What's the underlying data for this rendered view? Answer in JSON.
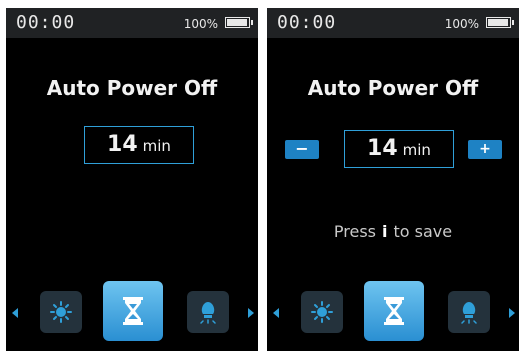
{
  "status": {
    "time": "00:00",
    "battery_percent": "100%",
    "battery_level": 1.0
  },
  "panels": [
    {
      "title": "Auto Power Off",
      "value": "14",
      "unit": "min"
    },
    {
      "title": "Auto Power Off",
      "value": "14",
      "unit": "min",
      "minus_label": "−",
      "plus_label": "+",
      "hint_prefix": "Press",
      "hint_key": "i",
      "hint_suffix": "to save"
    }
  ],
  "menu_icons": [
    "brightness-icon",
    "timer-icon",
    "lamp-icon"
  ],
  "selected_icon": "timer-icon",
  "colors": {
    "accent": "#2f9fd8",
    "selected_top": "#6ec4f0",
    "selected_bottom": "#2a8fd2",
    "tile": "#24323c",
    "statusbar": "#202224"
  }
}
